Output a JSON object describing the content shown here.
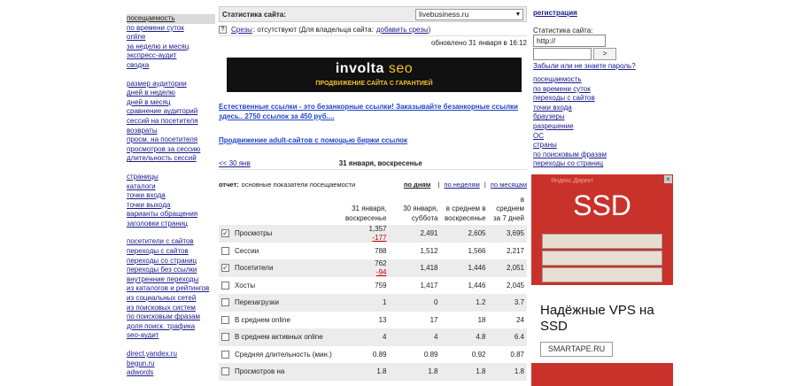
{
  "left_menu": {
    "groups": [
      [
        "посещаемость",
        "по времени суток",
        "online",
        "за неделю и месяц",
        "экспресс-аудит",
        "сводка"
      ],
      [
        "размер аудитории",
        "дней в неделю",
        "дней в месяц",
        "сравнение аудиторий",
        "сессий на посетителя",
        "возвраты",
        "просм. на посетителя",
        "просмотров за сессию",
        "длительность сессий"
      ],
      [
        "страницы",
        "каталоги",
        "точки входа",
        "точки выхода",
        "варианты обращения",
        "заголовки страниц"
      ],
      [
        "посетители с сайтов",
        "переходы с сайтов",
        "переходы со страниц",
        "переходы без ссылки",
        "внутренние переходы",
        "из каталогов и рейтингов",
        "из социальных сетей",
        "из поисковых систем",
        "по поисковым фразам",
        "доля поиск. трафика",
        "seo-аудит"
      ],
      [
        "direct.yandex.ru",
        "begun.ru",
        "adwords"
      ]
    ]
  },
  "main": {
    "stat_label": "Статистика сайта:",
    "site_select": "livebusiness.ru",
    "cuts_link": "Срезы",
    "cuts_text": ": отсутствуют (Для владельца сайта:",
    "cuts_add": "добавить срезы",
    "cuts_close": ")",
    "updated": "обновлено 31 января в 16:12",
    "banner_brand": "involta",
    "banner_brand2": "seo",
    "banner_tag": "ПРОДВИЖЕНИЕ САЙТА С ГАРАНТИЕЙ",
    "ad_link1": "Естественные ссылки - это безанкорные ссылки! Заказывайте безанкорные ссылки здесь.. 2750 ссылок за 450 руб....",
    "ad_link2": "Продвижение adult-сайтов с помощью биржи ссылок",
    "prev_day": "<< 30 янв",
    "current_day": "31 января, воскресенье",
    "report_label": "отчет:",
    "report_name": "основные показатели посещаемости",
    "periods": [
      "по дням",
      "по неделям",
      "по месяцам"
    ],
    "headers": [
      "",
      "31 января, воскресенье",
      "30 января, суббота",
      "в среднем в воскресенье",
      "в среднем за 7 дней"
    ],
    "rows": [
      {
        "checked": true,
        "name": "Просмотры",
        "v1": "1,357",
        "d1": "-177",
        "v2": "2,491",
        "v3": "2,605",
        "v4": "3,695"
      },
      {
        "checked": false,
        "name": "Сессии",
        "v1": "788",
        "d1": "",
        "v2": "1,512",
        "v3": "1,566",
        "v4": "2,217"
      },
      {
        "checked": true,
        "name": "Посетители",
        "v1": "762",
        "d1": "-94",
        "v2": "1,418",
        "v3": "1,446",
        "v4": "2,051"
      },
      {
        "checked": false,
        "name": "Хосты",
        "v1": "759",
        "d1": "",
        "v2": "1,417",
        "v3": "1,446",
        "v4": "2,045"
      },
      {
        "checked": false,
        "name": "Перезагрузки",
        "v1": "1",
        "d1": "",
        "v2": "0",
        "v3": "1.2",
        "v4": "3.7"
      },
      {
        "checked": false,
        "name": "В среднем online",
        "v1": "13",
        "d1": "",
        "v2": "17",
        "v3": "18",
        "v4": "24"
      },
      {
        "checked": false,
        "name": "В среднем активных online",
        "v1": "4",
        "d1": "",
        "v2": "4",
        "v3": "4.8",
        "v4": "6.4"
      },
      {
        "checked": false,
        "name": "Средняя длительность (мин.)",
        "v1": "0.89",
        "d1": "",
        "v2": "0.89",
        "v3": "0.92",
        "v4": "0.87"
      },
      {
        "checked": false,
        "name": "Просмотров на",
        "v1": "1.8",
        "d1": "",
        "v2": "1.8",
        "v3": "1.8",
        "v4": "1.8"
      }
    ]
  },
  "right": {
    "register": "регистрация",
    "stat_label": "Статистика сайта:",
    "input_value": "http://",
    "go_button": ">",
    "forgot": "Забыли или не знаете пароль?",
    "menu": [
      "посещаемость",
      "по времени суток",
      "переходы с сайтов",
      "точки входа",
      "браузеры",
      "разрешение",
      "ОС",
      "страны",
      "по поисковым фразам",
      "переходы со страниц"
    ]
  },
  "ad": {
    "yd_label": "Яндекс.Директ",
    "ssd": "SSD",
    "title": "Надёжные VPS на SSD",
    "domain": "SMARTAPE.RU",
    "close": "×"
  }
}
